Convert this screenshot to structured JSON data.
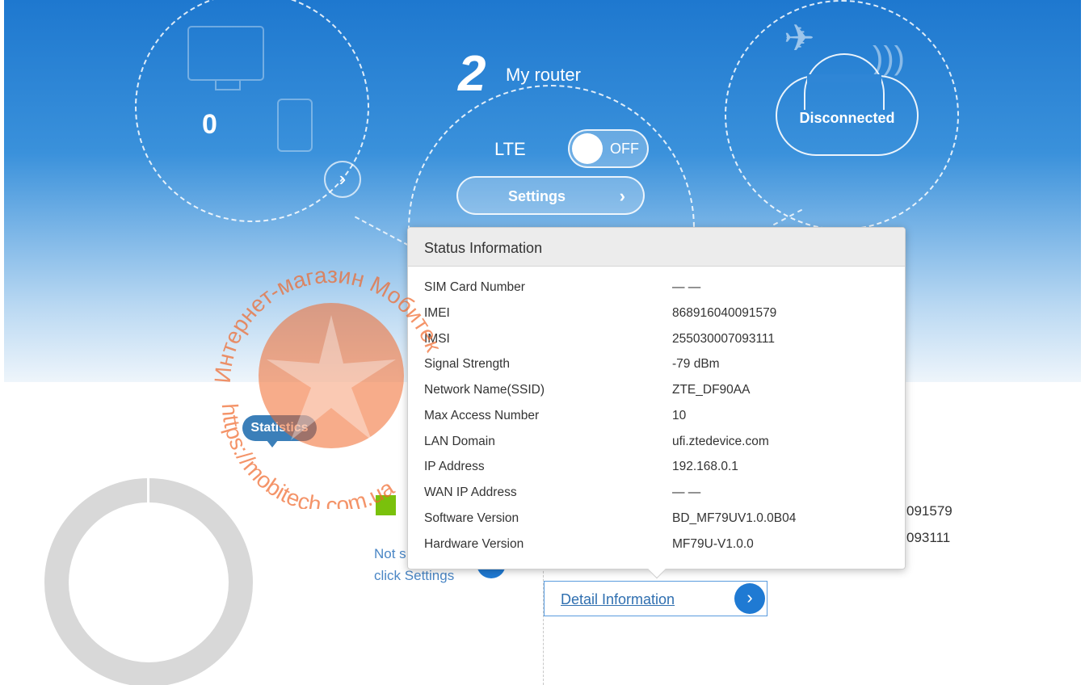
{
  "devices": {
    "count": "0"
  },
  "router": {
    "number": "2",
    "title": "My router",
    "lte_label": "LTE",
    "lte_state": "OFF",
    "settings_label": "Settings"
  },
  "network": {
    "status": "Disconnected"
  },
  "statistics": {
    "tag": "Statistics"
  },
  "not_set": {
    "line1": "Not s",
    "line2": "click Settings"
  },
  "partial_values": {
    "imei_tail": "091579",
    "imsi_tail": "093111"
  },
  "detail_button": {
    "label": "Detail Information"
  },
  "popup": {
    "title": "Status Information",
    "rows": [
      {
        "label": "SIM Card Number",
        "value": "— —"
      },
      {
        "label": "IMEI",
        "value": "868916040091579"
      },
      {
        "label": "IMSI",
        "value": "255030007093111"
      },
      {
        "label": "Signal Strength",
        "value": "-79 dBm"
      },
      {
        "label": "Network Name(SSID)",
        "value": "ZTE_DF90AA"
      },
      {
        "label": "Max Access Number",
        "value": "10"
      },
      {
        "label": "LAN Domain",
        "value": "ufi.ztedevice.com"
      },
      {
        "label": "IP Address",
        "value": "192.168.0.1"
      },
      {
        "label": "WAN IP Address",
        "value": "— —"
      },
      {
        "label": "Software Version",
        "value": "BD_MF79UV1.0.0B04"
      },
      {
        "label": "Hardware Version",
        "value": "MF79U-V1.0.0"
      }
    ]
  },
  "watermark": {
    "top_text": "Интернет-магазин Мобитек",
    "bottom_text": "https://mobitech.com.ua"
  },
  "colors": {
    "brand_blue": "#1e78cf",
    "accent_green": "#7ac10c",
    "watermark": "#f0672a"
  }
}
